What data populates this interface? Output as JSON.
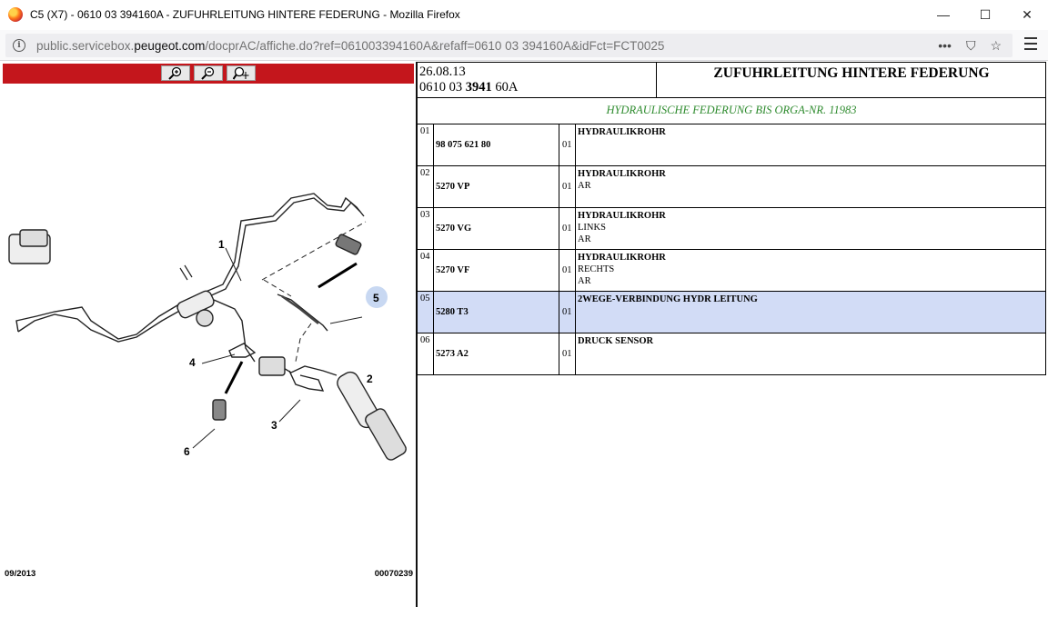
{
  "window": {
    "title": "C5 (X7) - 0610 03 394160A - ZUFUHRLEITUNG HINTERE FEDERUNG - Mozilla Firefox",
    "minimize": "—",
    "maximize": "☐",
    "close": "✕"
  },
  "urlbar": {
    "prefix": "public.servicebox.",
    "domain": "peugeot.com",
    "path": "/docprAC/affiche.do?ref=061003394160A&refaff=0610 03 394160A&idFct=FCT0025",
    "more": "•••",
    "pocket": "⛉",
    "bookmark": "☆"
  },
  "toolbar": {
    "zoom_in_icon": "zoom-in",
    "zoom_out_icon": "zoom-out",
    "zoom_move_icon": "zoom-move"
  },
  "diagram": {
    "callouts": [
      "1",
      "2",
      "3",
      "4",
      "5",
      "6"
    ],
    "footer_left": "09/2013",
    "footer_right": "00070239"
  },
  "header": {
    "date": "26.08.13",
    "ref_pre": "0610 03 ",
    "ref_bold": "3941",
    "ref_post": " 60A",
    "title": "ZUFUHRLEITUNG HINTERE FEDERUNG",
    "subtitle": "HYDRAULISCHE FEDERUNG BIS ORGA-NR. 11983",
    "subtitle_color": "#2e8b2e"
  },
  "parts": [
    {
      "no": "01",
      "ref": "98 075 621 80",
      "qty": "01",
      "name": "HYDRAULIKROHR",
      "detail1": "",
      "detail2": ""
    },
    {
      "no": "02",
      "ref": "5270 VP",
      "qty": "01",
      "name": "HYDRAULIKROHR",
      "detail1": "AR",
      "detail2": ""
    },
    {
      "no": "03",
      "ref": "5270 VG",
      "qty": "01",
      "name": "HYDRAULIKROHR",
      "detail1": "LINKS",
      "detail2": "AR"
    },
    {
      "no": "04",
      "ref": "5270 VF",
      "qty": "01",
      "name": "HYDRAULIKROHR",
      "detail1": "RECHTS",
      "detail2": "AR"
    },
    {
      "no": "05",
      "ref": "5280 T3",
      "qty": "01",
      "name": "2WEGE-VERBINDUNG HYDR LEITUNG",
      "detail1": "",
      "detail2": ""
    },
    {
      "no": "06",
      "ref": "5273 A2",
      "qty": "01",
      "name": "DRUCK SENSOR",
      "detail1": "",
      "detail2": ""
    }
  ],
  "colors": {
    "toolbar_red": "#c4161c",
    "highlight_row": "#d2dcf6"
  }
}
